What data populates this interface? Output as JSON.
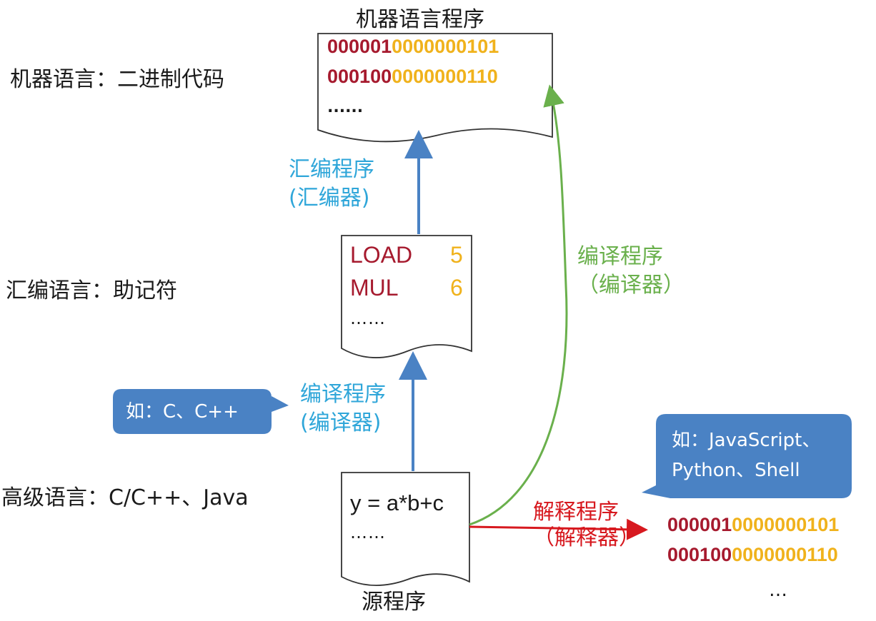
{
  "title_top": "机器语言程序",
  "levels": {
    "machine": "机器语言：二进制代码",
    "assembly": "汇编语言：助记符",
    "high": "高级语言：C/C++、Java"
  },
  "machine_doc": {
    "rows": [
      {
        "op": "000001",
        "addr": "0000000101"
      },
      {
        "op": "000100",
        "addr": "0000000110"
      }
    ],
    "more": "......"
  },
  "asm_doc": {
    "rows": [
      {
        "op": "LOAD",
        "arg": "5"
      },
      {
        "op": "MUL",
        "arg": "6"
      }
    ],
    "more": "……"
  },
  "source_doc": {
    "line": "y = a*b+c",
    "more": "……",
    "caption": "源程序"
  },
  "edges": {
    "assembler_l1": "汇编程序",
    "assembler_l2": "(汇编器)",
    "compiler_mid_l1": "编译程序",
    "compiler_mid_l2": "(编译器)",
    "compiler_right_l1": "编译程序",
    "compiler_right_l2": "（编译器）",
    "interp_l1": "解释程序",
    "interp_l2": "（解释器）"
  },
  "bubbles": {
    "compiled_examples": "如：C、C++",
    "interp_l1": "如：JavaScript、",
    "interp_l2": "Python、Shell"
  },
  "output": {
    "rows": [
      {
        "op": "000001",
        "addr": "0000000101"
      },
      {
        "op": "000100",
        "addr": "0000000110"
      }
    ],
    "more": "…"
  },
  "colors": {
    "blue_arrow": "#4a82c4",
    "green_arrow": "#6ab04c",
    "red_arrow": "#d7191f",
    "op_dark_red": "#a61a2e",
    "addr_yellow": "#f0b21c",
    "bubble": "#4a82c4"
  }
}
